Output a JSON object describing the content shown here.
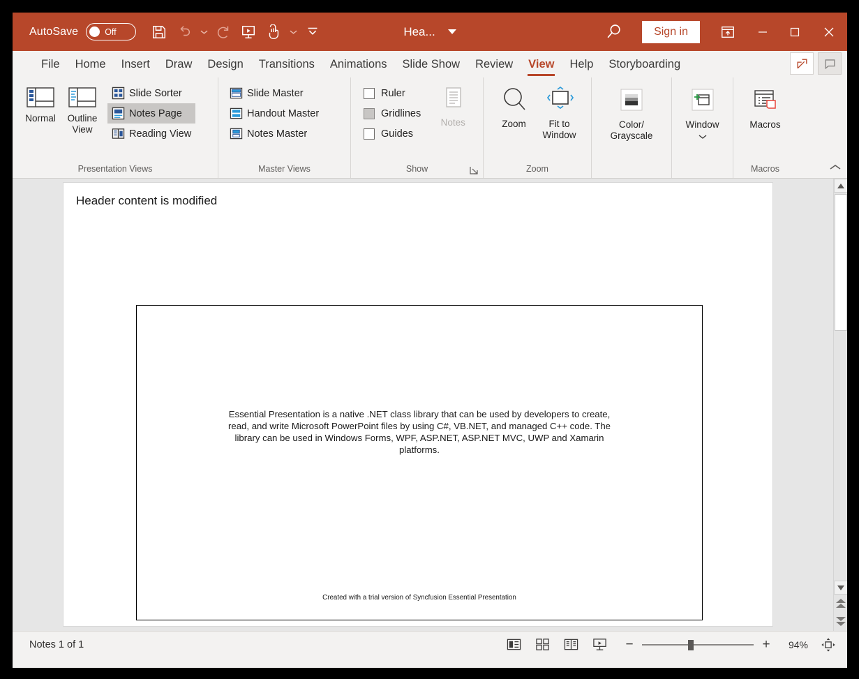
{
  "titlebar": {
    "autosave_label": "AutoSave",
    "autosave_state": "Off",
    "document_title": "Hea...",
    "signin_label": "Sign in",
    "accent_color": "#b7472a",
    "quick_access": [
      {
        "name": "save-icon",
        "label": "Save"
      },
      {
        "name": "undo-icon",
        "label": "Undo"
      },
      {
        "name": "redo-icon",
        "label": "Redo"
      },
      {
        "name": "start-from-beginning-icon",
        "label": "Start From Beginning"
      },
      {
        "name": "touch-mode-icon",
        "label": "Touch/Mouse Mode"
      },
      {
        "name": "customize-qat-icon",
        "label": "Customize Quick Access Toolbar"
      }
    ],
    "window_controls": {
      "ribbon_display": "Ribbon Display Options",
      "minimize": "Minimize",
      "maximize": "Restore Down",
      "close": "Close"
    }
  },
  "tabs": [
    {
      "label": "File",
      "active": false
    },
    {
      "label": "Home",
      "active": false
    },
    {
      "label": "Insert",
      "active": false
    },
    {
      "label": "Draw",
      "active": false
    },
    {
      "label": "Design",
      "active": false
    },
    {
      "label": "Transitions",
      "active": false
    },
    {
      "label": "Animations",
      "active": false
    },
    {
      "label": "Slide Show",
      "active": false
    },
    {
      "label": "Review",
      "active": false
    },
    {
      "label": "View",
      "active": true
    },
    {
      "label": "Help",
      "active": false
    },
    {
      "label": "Storyboarding",
      "active": false
    }
  ],
  "tabbar_right": [
    {
      "name": "share-icon",
      "label": "Share"
    },
    {
      "name": "comments-icon",
      "label": "Comments"
    }
  ],
  "ribbon": {
    "groups": [
      {
        "name": "presentation-views",
        "label": "Presentation Views",
        "big_buttons": [
          {
            "label": "Normal",
            "icon": "normal-view-icon"
          },
          {
            "label": "Outline View",
            "icon": "outline-view-icon"
          }
        ],
        "small_buttons": [
          {
            "label": "Slide Sorter",
            "icon": "slide-sorter-icon",
            "selected": false
          },
          {
            "label": "Notes Page",
            "icon": "notes-page-icon",
            "selected": true
          },
          {
            "label": "Reading View",
            "icon": "reading-view-icon",
            "selected": false
          }
        ]
      },
      {
        "name": "master-views",
        "label": "Master Views",
        "small_buttons": [
          {
            "label": "Slide Master",
            "icon": "slide-master-icon"
          },
          {
            "label": "Handout Master",
            "icon": "handout-master-icon"
          },
          {
            "label": "Notes Master",
            "icon": "notes-master-icon"
          }
        ]
      },
      {
        "name": "show",
        "label": "Show",
        "checkboxes": [
          {
            "label": "Ruler",
            "checked": false,
            "filled": false
          },
          {
            "label": "Gridlines",
            "checked": false,
            "filled": true
          },
          {
            "label": "Guides",
            "checked": false,
            "filled": false
          }
        ],
        "notes_button": {
          "label": "Notes",
          "disabled": true,
          "icon": "notes-icon"
        },
        "has_dialog_launcher": true
      },
      {
        "name": "zoom",
        "label": "Zoom",
        "big_buttons": [
          {
            "label": "Zoom",
            "icon": "magnifier-icon"
          },
          {
            "label": "Fit to Window",
            "icon": "fit-to-window-icon"
          }
        ]
      },
      {
        "name": "color-grayscale",
        "label": "",
        "big_buttons": [
          {
            "label": "Color/ Grayscale",
            "icon": "color-grayscale-icon",
            "dropdown": true
          }
        ]
      },
      {
        "name": "window",
        "label": "",
        "big_buttons": [
          {
            "label": "Window",
            "icon": "new-window-icon",
            "dropdown": true
          }
        ]
      },
      {
        "name": "macros",
        "label": "Macros",
        "big_buttons": [
          {
            "label": "Macros",
            "icon": "macros-icon"
          }
        ]
      }
    ],
    "collapse_label": "Collapse the Ribbon"
  },
  "notes_page": {
    "header_text": "Header content is modified",
    "slide": {
      "body_text": "Essential Presentation is a native .NET class library that can be used by developers to create, read, and write Microsoft PowerPoint files by using C#, VB.NET, and managed C++ code. The library can be used in Windows Forms, WPF, ASP.NET, ASP.NET MVC, UWP and Xamarin platforms.",
      "footer_text": "Created with a trial version of Syncfusion Essential Presentation"
    }
  },
  "scrollbar": {
    "up_arrow": "Line up",
    "down_arrow": "Line down",
    "previous_slide": "Previous Slide",
    "next_slide": "Next Slide"
  },
  "statusbar": {
    "status_text": "Notes 1 of 1",
    "view_buttons": [
      {
        "name": "normal-view-button",
        "label": "Normal"
      },
      {
        "name": "slide-sorter-button",
        "label": "Slide Sorter"
      },
      {
        "name": "reading-view-button",
        "label": "Reading View"
      },
      {
        "name": "slide-show-button",
        "label": "Slide Show"
      }
    ],
    "zoom_out": "−",
    "zoom_in": "+",
    "zoom_percent": "94%",
    "fit_slide_label": "Fit slide to current window"
  }
}
